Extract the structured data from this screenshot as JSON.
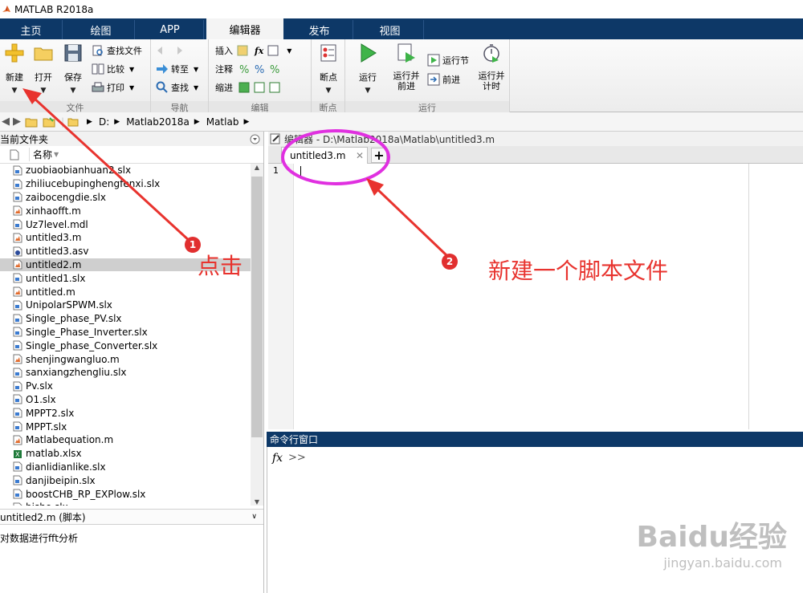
{
  "window": {
    "title": "MATLAB R2018a"
  },
  "tabs": [
    {
      "label": "主页"
    },
    {
      "label": "绘图"
    },
    {
      "label": "APP"
    },
    {
      "label": "编辑器"
    },
    {
      "label": "发布"
    },
    {
      "label": "视图"
    }
  ],
  "ribbon": {
    "file": {
      "new_label": "新建",
      "open_label": "打开",
      "save_label": "保存",
      "find_files_label": "查找文件",
      "compare_label": "比较",
      "print_label": "打印",
      "group_label": "文件"
    },
    "navigate": {
      "goto_label": "转至",
      "find_label": "查找",
      "group_label": "导航"
    },
    "edit": {
      "insert_label": "插入",
      "comment_label": "注释",
      "indent_label": "缩进",
      "fx_label": "fx",
      "group_label": "编辑"
    },
    "breakpoints": {
      "breakpoint_label": "断点",
      "group_label": "断点"
    },
    "run": {
      "run_label": "运行",
      "run_advance_label": "运行并\n前进",
      "run_section_label": "运行节",
      "advance_label": "前进",
      "run_time_label": "运行并\n计时",
      "group_label": "运行"
    }
  },
  "address": {
    "crumbs": [
      "D:",
      "Matlab2018a",
      "Matlab"
    ]
  },
  "current_folder": {
    "title": "当前文件夹",
    "column_name": "名称",
    "files": [
      {
        "name": "zuobiaobianhuan2.slx",
        "type": "slx"
      },
      {
        "name": "zhiliucebupinghengfenxi.slx",
        "type": "slx"
      },
      {
        "name": "zaibocengdie.slx",
        "type": "slx"
      },
      {
        "name": "xinhaofft.m",
        "type": "m"
      },
      {
        "name": "Uz7level.mdl",
        "type": "mdl"
      },
      {
        "name": "untitled3.m",
        "type": "m"
      },
      {
        "name": "untitled3.asv",
        "type": "asv"
      },
      {
        "name": "untitled2.m",
        "type": "m",
        "selected": true
      },
      {
        "name": "untitled1.slx",
        "type": "slx"
      },
      {
        "name": "untitled.m",
        "type": "m"
      },
      {
        "name": "UnipolarSPWM.slx",
        "type": "slx"
      },
      {
        "name": "Single_phase_PV.slx",
        "type": "slx"
      },
      {
        "name": "Single_Phase_Inverter.slx",
        "type": "slx"
      },
      {
        "name": "Single_phase_Converter.slx",
        "type": "slx"
      },
      {
        "name": "shenjingwangluo.m",
        "type": "m"
      },
      {
        "name": "sanxiangzhengliu.slx",
        "type": "slx"
      },
      {
        "name": "Pv.slx",
        "type": "slx"
      },
      {
        "name": "O1.slx",
        "type": "slx"
      },
      {
        "name": "MPPT2.slx",
        "type": "slx"
      },
      {
        "name": "MPPT.slx",
        "type": "slx"
      },
      {
        "name": "Matlabequation.m",
        "type": "m"
      },
      {
        "name": "matlab.xlsx",
        "type": "xlsx"
      },
      {
        "name": "dianlidianlike.slx",
        "type": "slx"
      },
      {
        "name": "danjibeipin.slx",
        "type": "slx"
      },
      {
        "name": "boostCHB_RP_EXPlow.slx",
        "type": "slx"
      },
      {
        "name": "bishe.slx",
        "type": "slx"
      }
    ],
    "details_title": "untitled2.m  (脚本)",
    "details_desc": "对数据进行fft分析"
  },
  "editor": {
    "title": "编辑器 - D:\\Matlab2018a\\Matlab\\untitled3.m",
    "tab_label": "untitled3.m",
    "line_number": "1"
  },
  "command_window": {
    "title": "命令行窗口",
    "fx": "fx",
    "prompt": ">>"
  },
  "annotations": {
    "badge1": "1",
    "text1": "点击",
    "badge2": "2",
    "text2": "新建一个脚本文件",
    "color": "#e8332e",
    "ellipse_color": "#e030e0"
  },
  "watermark": {
    "main": "Baidu经验",
    "sub": "jingyan.baidu.com"
  }
}
